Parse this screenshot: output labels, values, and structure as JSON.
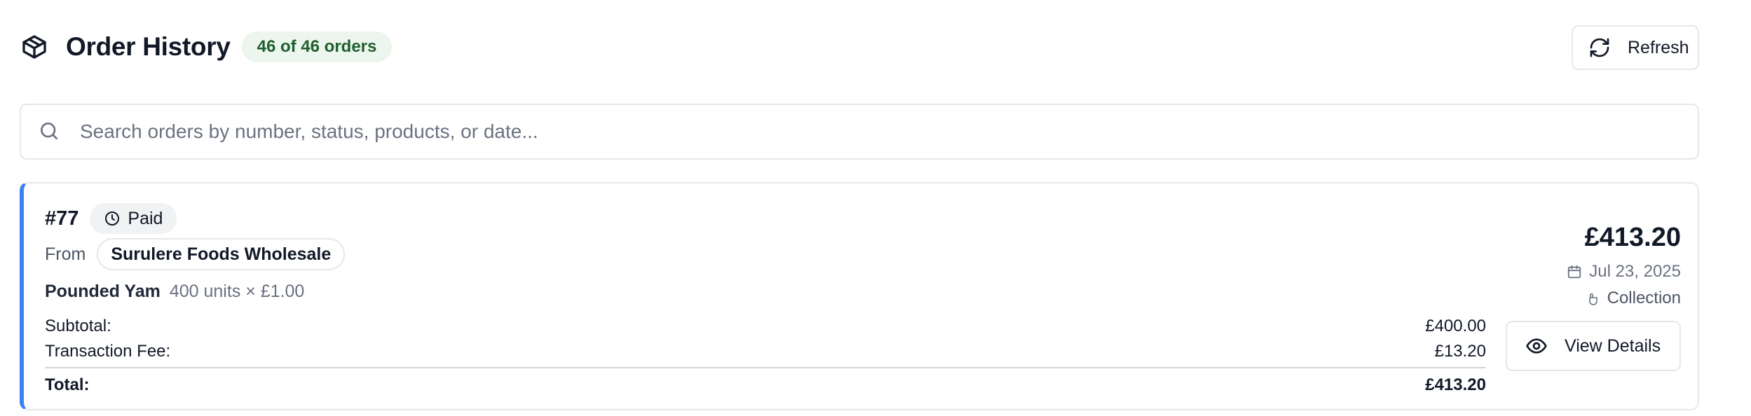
{
  "header": {
    "title": "Order History",
    "count_badge": "46 of 46 orders",
    "refresh_label": "Refresh",
    "title_icon": "package-icon",
    "refresh_icon": "refresh-icon"
  },
  "search": {
    "placeholder": "Search orders by number, status, products, or date...",
    "value": "",
    "icon": "search-icon"
  },
  "orders": [
    {
      "number": "#77",
      "status": "Paid",
      "status_icon": "clock-icon",
      "from_label": "From",
      "supplier": "Surulere Foods Wholesale",
      "product_name": "Pounded Yam",
      "product_qty": "400 units × £1.00",
      "subtotal_label": "Subtotal:",
      "subtotal": "£400.00",
      "fee_label": "Transaction Fee:",
      "fee": "£13.20",
      "total_label": "Total:",
      "total": "£413.20",
      "amount": "£413.20",
      "date": "Jul 23, 2025",
      "fulfilment": "Collection",
      "view_label": "View Details",
      "accent_color": "#3b82f6"
    }
  ],
  "colors": {
    "badge_bg": "#ecf5ee",
    "badge_text": "#1f5f2e",
    "border": "#e5e7eb",
    "accent": "#3b82f6"
  }
}
